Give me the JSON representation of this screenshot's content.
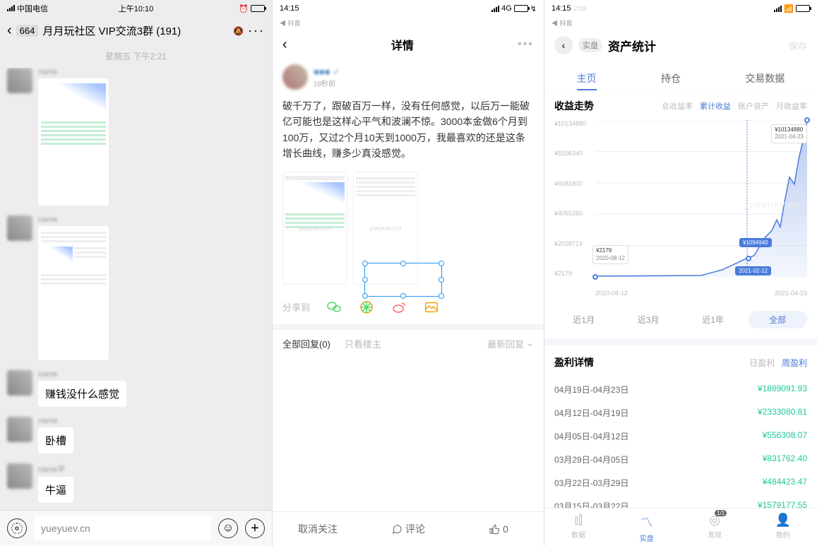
{
  "col1": {
    "status": {
      "carrier": "中国电信",
      "time": "上午10:10"
    },
    "header": {
      "badge": "664",
      "title": "月月玩社区 VIP交流3群 (191)"
    },
    "daystamp": "星期五 下午2:21",
    "msgs": [
      {
        "text": "赚钱没什么感觉"
      },
      {
        "text": "卧槽"
      },
      {
        "text": "牛逼"
      }
    ],
    "input_text": "yueyuev.cn"
  },
  "col2": {
    "status_time": "14:15",
    "status_net": "4G",
    "sub": "◀ 抖音",
    "title": "详情",
    "post_time": "18秒前",
    "text": "破千万了，跟破百万一样，没有任何感觉，以后万一能破亿可能也是这样心平气和波澜不惊。3000本金做6个月到100万，又过2个月10天到1000万，我最喜欢的还是这条增长曲线，赚多少真没感觉。",
    "watermark": "yueyuev.cn",
    "share_label": "分享到",
    "reply_tabs": {
      "all": "全部回复(0)",
      "owner": "只看楼主",
      "sort": "最新回复"
    },
    "bottom": {
      "unfollow": "取消关注",
      "comment": "评论",
      "like": "0"
    }
  },
  "col3": {
    "status_time": "14:15",
    "status_time2": "2:03",
    "sub": "◀ 抖音",
    "pill": "实盘",
    "title": "资产统计",
    "save": "保存",
    "tabs": [
      "主页",
      "持仓",
      "交易数据"
    ],
    "active_tab": 0,
    "card_title": "收益走势",
    "subtabs": [
      "总收益率",
      "累计收益",
      "账户资产",
      "月收益率"
    ],
    "active_subtab": 1,
    "watermark": "yueyuev.cn",
    "periods": [
      "近1月",
      "近3月",
      "近1年",
      "全部"
    ],
    "active_period": 3,
    "profit_title": "盈利详情",
    "profit_tabs": {
      "day": "日盈利",
      "week": "周盈利"
    },
    "profits": [
      {
        "date": "04月19日-04月23日",
        "val": "¥1889091.93"
      },
      {
        "date": "04月12日-04月19日",
        "val": "¥2333080.81"
      },
      {
        "date": "04月05日-04月12日",
        "val": "¥556308.07"
      },
      {
        "date": "03月29日-04月05日",
        "val": "¥831762.40"
      },
      {
        "date": "03月22日-03月29日",
        "val": "¥484423.47"
      },
      {
        "date": "03月15日-03月22日",
        "val": "¥1579177.55"
      }
    ],
    "nav": [
      {
        "label": "数据"
      },
      {
        "label": "实盘"
      },
      {
        "label": "发现"
      },
      {
        "label": "我的"
      }
    ],
    "nav_badge": "1/1"
  },
  "chart_data": {
    "type": "area",
    "title": "收益走势 - 累计收益",
    "ylabel": "¥",
    "ylim": [
      2179,
      10134880
    ],
    "y_ticks": [
      "¥10134880",
      "¥8108340",
      "¥6081800",
      "¥4055260",
      "¥2028719",
      "¥2179"
    ],
    "x_range": [
      "2020-08-12",
      "2021-04-23"
    ],
    "annotations": [
      {
        "x": "2020-08-12",
        "y": 2179,
        "label": "¥2179"
      },
      {
        "x": "2021-02-12",
        "y": 1094940,
        "label": "¥1094940"
      },
      {
        "x": "2021-04-23",
        "y": 10134880,
        "label": "¥10134880"
      }
    ],
    "series": [
      {
        "name": "累计收益",
        "approx_path": "flat near 0 until ~2021-01, rises to ~1.1M by 2021-02-12, exponential to 10.13M by 2021-04-23"
      }
    ]
  }
}
